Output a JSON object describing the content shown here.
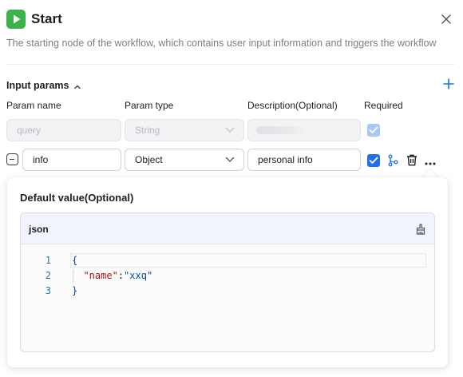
{
  "header": {
    "title": "Start",
    "description": "The starting node of the workflow, which contains user input information and triggers the workflow",
    "icons": {
      "node": "play-icon",
      "close": "close-icon"
    }
  },
  "input_params": {
    "section_title": "Input params",
    "columns": {
      "name": "Param name",
      "type": "Param type",
      "description": "Description(Optional)",
      "required": "Required"
    },
    "rows": [
      {
        "name_placeholder": "query",
        "type": "String",
        "description": "",
        "required": true,
        "disabled": true
      },
      {
        "name": "info",
        "type": "Object",
        "description": "personal info",
        "required": true,
        "disabled": false
      }
    ]
  },
  "default_value": {
    "title": "Default value(Optional)",
    "language": "json",
    "line_numbers": [
      "1",
      "2",
      "3"
    ],
    "code": {
      "open": "{",
      "key": "\"name\"",
      "colon": ":",
      "value": "\"xxq\"",
      "close": "}"
    }
  },
  "colors": {
    "accent": "#1f6fef",
    "start_icon": "#3bb24a",
    "json_key": "#a31515",
    "json_value": "#0451a5"
  }
}
